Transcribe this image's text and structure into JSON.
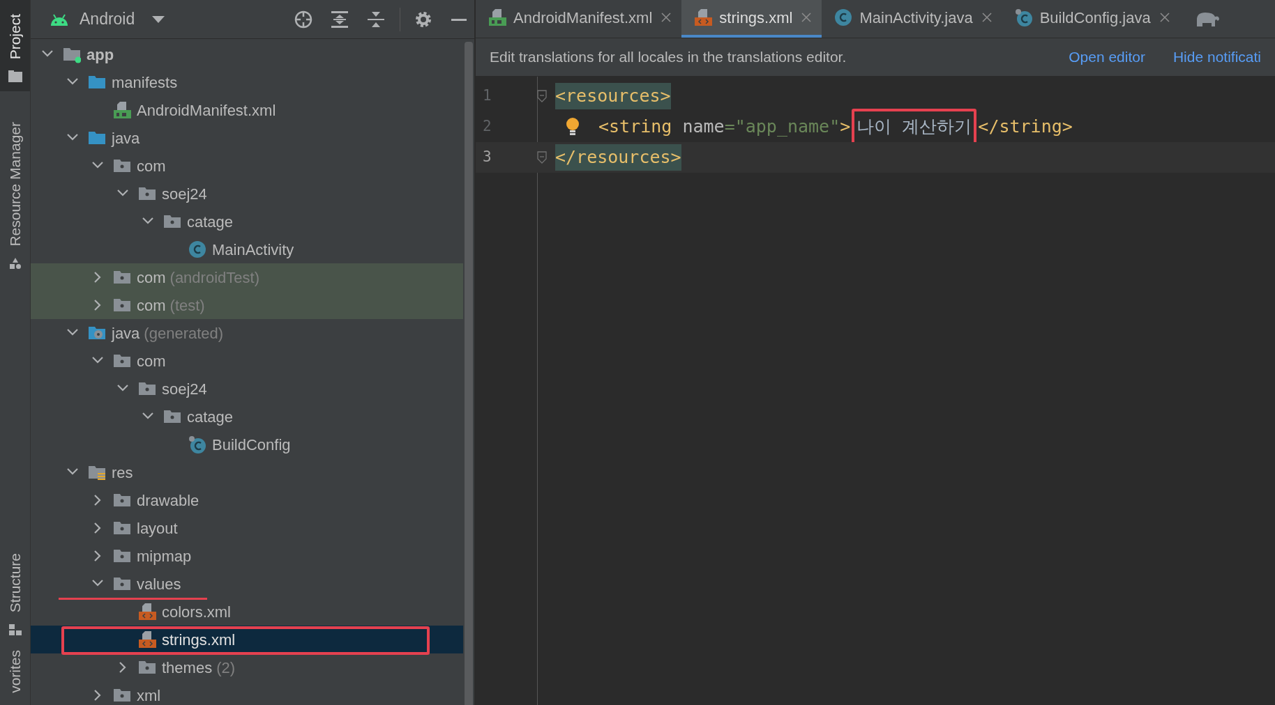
{
  "side_stripe": [
    {
      "label": "Project",
      "selected": true,
      "kind": "project"
    },
    {
      "label": "Resource Manager",
      "selected": false,
      "kind": "resources"
    },
    {
      "label": "Structure",
      "selected": false,
      "kind": "structure"
    },
    {
      "label": "vorites",
      "selected": false,
      "kind": "none"
    }
  ],
  "project_panel": {
    "view": "Android"
  },
  "tree": [
    {
      "label": "app",
      "kind": "module",
      "expanded": true,
      "selected": false,
      "children": [
        {
          "label": "manifests",
          "kind": "source-folder",
          "expanded": true,
          "selected": false,
          "children": [
            {
              "label": "AndroidManifest.xml",
              "kind": "manifest-file",
              "selected": false
            }
          ]
        },
        {
          "label": "java",
          "kind": "source-folder",
          "expanded": true,
          "selected": false,
          "children": [
            {
              "label": "com",
              "kind": "package",
              "expanded": true,
              "selected": false,
              "children": [
                {
                  "label": "soej24",
                  "kind": "package",
                  "expanded": true,
                  "selected": false,
                  "children": [
                    {
                      "label": "catage",
                      "kind": "package",
                      "expanded": true,
                      "selected": false,
                      "children": [
                        {
                          "label": "MainActivity",
                          "kind": "class",
                          "selected": false
                        }
                      ]
                    }
                  ]
                }
              ]
            },
            {
              "label": "com",
              "suffix": "(androidTest)",
              "kind": "package",
              "expanded": false,
              "selected": false,
              "test_scope": true
            },
            {
              "label": "com",
              "suffix": "(test)",
              "kind": "package",
              "expanded": false,
              "selected": false,
              "test_scope": true
            }
          ]
        },
        {
          "label": "java",
          "suffix": "(generated)",
          "kind": "generated-folder",
          "expanded": true,
          "selected": false,
          "children": [
            {
              "label": "com",
              "kind": "package",
              "expanded": true,
              "selected": false,
              "children": [
                {
                  "label": "soej24",
                  "kind": "package",
                  "expanded": true,
                  "selected": false,
                  "children": [
                    {
                      "label": "catage",
                      "kind": "package",
                      "expanded": true,
                      "selected": false,
                      "children": [
                        {
                          "label": "BuildConfig",
                          "kind": "generated-class",
                          "selected": false
                        }
                      ]
                    }
                  ]
                }
              ]
            }
          ]
        },
        {
          "label": "res",
          "kind": "res-folder",
          "expanded": true,
          "selected": false,
          "children": [
            {
              "label": "drawable",
              "kind": "package",
              "expanded": false,
              "selected": false
            },
            {
              "label": "layout",
              "kind": "package",
              "expanded": false,
              "selected": false
            },
            {
              "label": "mipmap",
              "kind": "package",
              "expanded": false,
              "selected": false
            },
            {
              "label": "values",
              "kind": "package",
              "expanded": true,
              "selected": false,
              "underlined": true,
              "children": [
                {
                  "label": "colors.xml",
                  "kind": "xml-file",
                  "selected": false
                },
                {
                  "label": "strings.xml",
                  "kind": "xml-file",
                  "selected": true,
                  "boxed": true
                },
                {
                  "label": "themes",
                  "suffix": "(2)",
                  "kind": "package",
                  "expanded": false,
                  "selected": false
                }
              ]
            },
            {
              "label": "xml",
              "kind": "package",
              "expanded": false,
              "selected": false
            }
          ]
        }
      ]
    }
  ],
  "tabs": [
    {
      "label": "AndroidManifest.xml",
      "kind": "manifest-file",
      "selected": false
    },
    {
      "label": "strings.xml",
      "kind": "xml-file",
      "selected": true
    },
    {
      "label": "MainActivity.java",
      "kind": "class",
      "selected": false
    },
    {
      "label": "BuildConfig.java",
      "kind": "generated-class",
      "selected": false
    }
  ],
  "notification": {
    "text": "Edit translations for all locales in the translations editor.",
    "links": [
      "Open editor",
      "Hide notificati"
    ]
  },
  "editor": {
    "lines": [
      {
        "number": "1",
        "current": false,
        "fold_marker": true,
        "bulb": false,
        "tokens": [
          {
            "kind": "tag",
            "text": "<resources>",
            "matched": true
          }
        ]
      },
      {
        "number": "2",
        "current": false,
        "fold_marker": false,
        "bulb": true,
        "indented": true,
        "tokens": [
          {
            "kind": "tag",
            "text": "<string"
          },
          {
            "kind": "attr",
            "text": " name"
          },
          {
            "kind": "value",
            "text": "=\"app_name\""
          },
          {
            "kind": "tag",
            "text": ">"
          },
          {
            "kind": "text",
            "text": "나이 계산하기",
            "boxed": true
          },
          {
            "kind": "tag",
            "text": "</string>"
          }
        ]
      },
      {
        "number": "3",
        "current": true,
        "fold_marker": true,
        "bulb": false,
        "tokens": [
          {
            "kind": "tag",
            "text": "</resources>",
            "matched": true
          }
        ]
      }
    ]
  }
}
